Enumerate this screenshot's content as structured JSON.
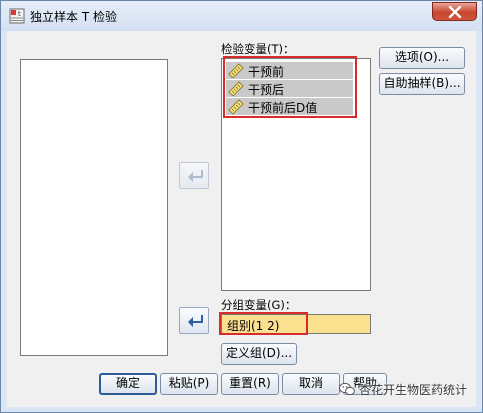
{
  "window": {
    "title": "独立样本 T 检验"
  },
  "labels": {
    "test_vars": "检验变量(T)：",
    "group_var": "分组变量(G)："
  },
  "test_variables": [
    {
      "name": "干预前"
    },
    {
      "name": "干预后"
    },
    {
      "name": "干预前后D值"
    }
  ],
  "group_variable": {
    "value": "组别(1 2)"
  },
  "buttons": {
    "options": "选项(O)...",
    "bootstrap": "自助抽样(B)...",
    "define_groups": "定义组(D)...",
    "ok": "确定",
    "paste": "粘贴(P)",
    "reset": "重置(R)",
    "cancel": "取消",
    "help": "帮助"
  },
  "watermark": {
    "text": "杏花开生物医药统计"
  },
  "colors": {
    "highlight": "#d72c2c",
    "group_field_bg": "#fbe08f",
    "selected_item_bg": "#c9c9c9"
  },
  "icons": {
    "variable": "ruler-icon",
    "move": "move-arrow-icon",
    "close": "close-icon",
    "app": "spss-app-icon"
  }
}
